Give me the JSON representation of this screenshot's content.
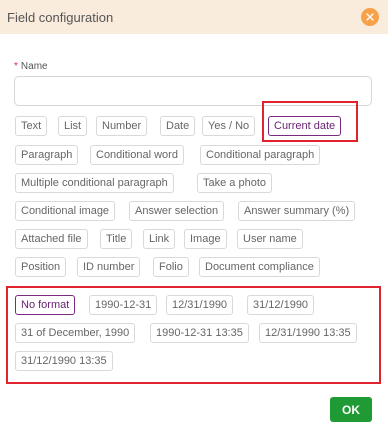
{
  "dialog": {
    "title": "Field configuration",
    "close_icon": "close-icon",
    "accent_color": "#f7a14a",
    "header_bg": "#faecdc"
  },
  "name_field": {
    "required_mark": "*",
    "label": "Name",
    "value": ""
  },
  "field_types": [
    "Text",
    "List",
    "Number",
    "Date",
    "Yes / No",
    "Current date",
    "Paragraph",
    "Conditional word",
    "Conditional paragraph",
    "Multiple conditional paragraph",
    "Take a photo",
    "Conditional image",
    "Answer selection",
    "Answer summary (%)",
    "Attached file",
    "Title",
    "Link",
    "Image",
    "User name",
    "Position",
    "ID number",
    "Folio",
    "Document compliance"
  ],
  "selected_field_type": "Current date",
  "date_formats": [
    "No format",
    "1990-12-31",
    "12/31/1990",
    "31/12/1990",
    "31 of December, 1990",
    "1990-12-31 13:35",
    "12/31/1990 13:35",
    "31/12/1990 13:35"
  ],
  "selected_date_format": "No format",
  "ok_button": {
    "label": "OK",
    "color": "#1f9a35"
  },
  "colors": {
    "selected_chip": "#7b2a83",
    "highlight_box": "#e0232e"
  }
}
